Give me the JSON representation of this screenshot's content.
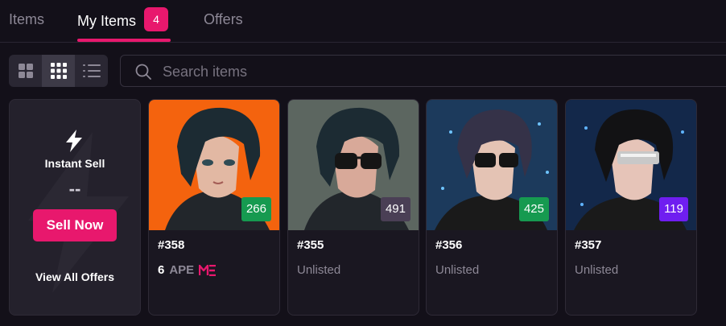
{
  "tabs": [
    {
      "label": "Items"
    },
    {
      "label": "My Items",
      "count": "4"
    },
    {
      "label": "Offers"
    }
  ],
  "search": {
    "placeholder": "Search items"
  },
  "view_modes": [
    "grid-large-icon",
    "grid-small-icon",
    "list-icon"
  ],
  "instant_sell": {
    "title": "Instant Sell",
    "value": "--",
    "button_label": "Sell Now",
    "link_label": "View All Offers"
  },
  "items": [
    {
      "name": "#358",
      "rank": "266",
      "rank_color": "#169a50",
      "status": "",
      "price": "6",
      "currency": "APE",
      "bg": "#f4630e"
    },
    {
      "name": "#355",
      "rank": "491",
      "rank_color": "#4a3f55",
      "status": "Unlisted",
      "bg": "#5c6660"
    },
    {
      "name": "#356",
      "rank": "425",
      "rank_color": "#169a50",
      "status": "Unlisted",
      "bg": "#1c3a5c"
    },
    {
      "name": "#357",
      "rank": "119",
      "rank_color": "#6f1ef0",
      "status": "Unlisted",
      "bg": "#13284a"
    }
  ],
  "colors": {
    "accent": "#e8186d",
    "background": "#131019"
  }
}
